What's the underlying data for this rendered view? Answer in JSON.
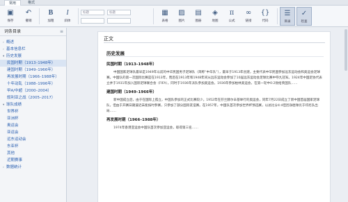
{
  "tabs": [
    {
      "label": "常用"
    },
    {
      "label": "格式"
    }
  ],
  "ribbon": {
    "save": "保存",
    "undo": "撤销",
    "bold": "加粗",
    "italic": "斜体",
    "style": "标题",
    "style2": "标题",
    "table": "表格",
    "image": "图片",
    "gallery": "图册",
    "map": "地图",
    "formula": "公式",
    "link": "链接",
    "code": "代码",
    "catalog": "目录",
    "check": "检查"
  },
  "sidebar": {
    "title": "词条目录",
    "items": [
      {
        "label": "概述",
        "level": 0
      },
      {
        "label": "基本信息栏",
        "level": 0
      },
      {
        "label": "历史发展",
        "level": 0
      },
      {
        "label": "民国时期（1913–1948年）",
        "level": 1
      },
      {
        "label": "建国时期（1949–1966年）",
        "level": 1
      },
      {
        "label": "再发展时期（1966–1988年）",
        "level": 1
      },
      {
        "label": "十年动乱（1988–1996年）",
        "level": 1
      },
      {
        "label": "甲A/中超（2000–2004）",
        "level": 1
      },
      {
        "label": "叙利亚之战（2005–2017）",
        "level": 1
      },
      {
        "label": "球队成绩",
        "level": 0
      },
      {
        "label": "世界杯",
        "level": 1
      },
      {
        "label": "亚洲杯",
        "level": 1
      },
      {
        "label": "奥运会",
        "level": 1
      },
      {
        "label": "亚运会",
        "level": 1
      },
      {
        "label": "远东运动会",
        "level": 1
      },
      {
        "label": "东亚杯",
        "level": 1
      },
      {
        "label": "其他",
        "level": 1
      },
      {
        "label": "近期赛事",
        "level": 1
      },
      {
        "label": "数据统计",
        "level": 0
      }
    ]
  },
  "doc": {
    "page_title": "正文",
    "section": "历史发展",
    "blocks": [
      {
        "heading": "民国时期（1913–1948年）",
        "text": "中国国家足球队最早是1949年以前的中华民国男子足球队（简称“中华队”），最早于1913年创建，主要代表中华民国参加远东运动会和奥运会足球赛。中国队的第一次国际比赛是在1913年，而后在1913年和1948年间从远东运动会参加了10届远东运动会足球比赛中夺九冠军。1924年中国足协代表立并于1931年加入国际足球联合会（FIFA），同时于1936年派队参加奥运会。1936年参加柏林奥运会，在第一轮中0:2败给英国队……"
      },
      {
        "heading": "建国时期（1949–1966年）",
        "text": "新中国成立后，由于在国际上孤立，中国队参加的正式比赛较少。1952年在芬兰赫尔辛基举行的奥运会，同年7月22日成立了新中国首届国家足球队，但由于开赛日期逼近未能按时参赛，只参加了部分国际友谊赛。在1957年，中国队首次参加世界杯预选赛，以总比分4:4但因净胜球劣于印尼队出局……"
      },
      {
        "heading": "再发展时期（1966–1988年）",
        "text": "1974年香港亚运会中国队首次参加亚运会，取得第三名……"
      }
    ]
  }
}
